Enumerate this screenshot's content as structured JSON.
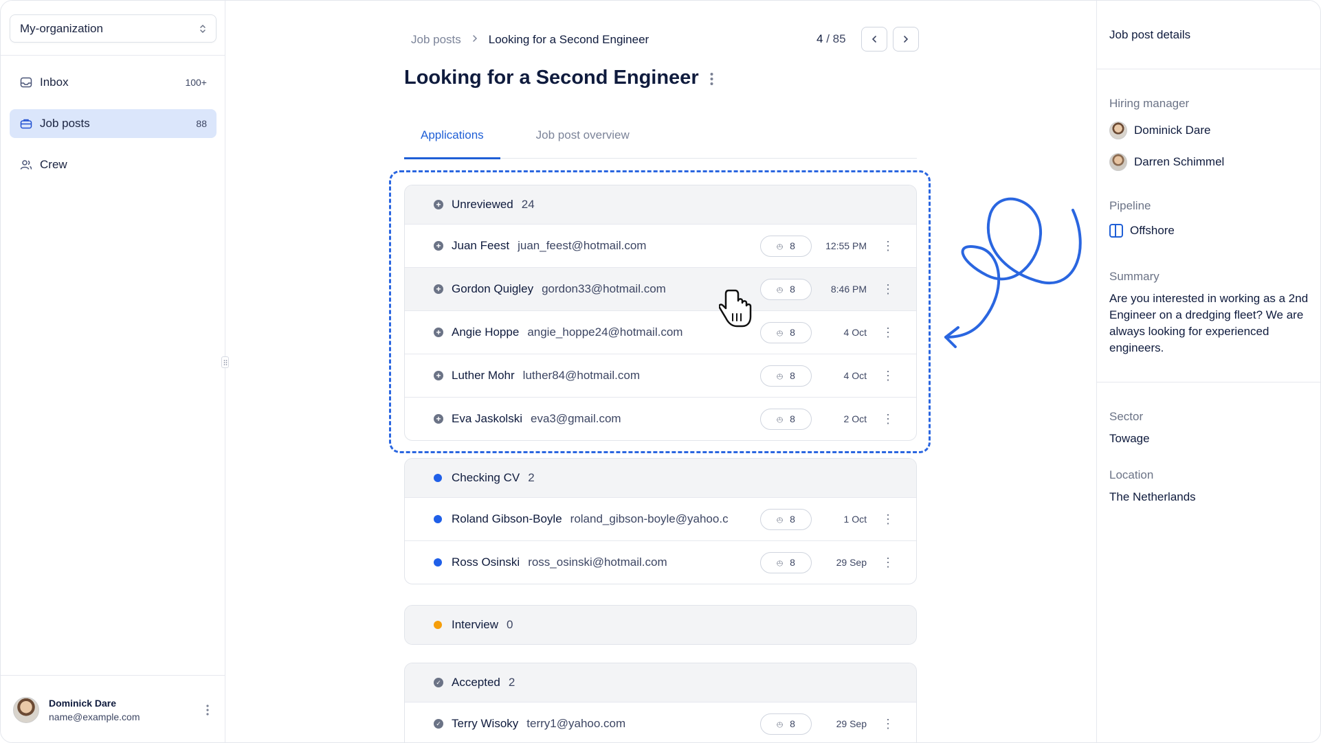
{
  "sidebar": {
    "org": "My-organization",
    "items": [
      {
        "label": "Inbox",
        "count": "100+",
        "icon": "inbox-icon"
      },
      {
        "label": "Job posts",
        "count": "88",
        "icon": "briefcase-icon"
      },
      {
        "label": "Crew",
        "count": "",
        "icon": "users-icon"
      }
    ],
    "user": {
      "name": "Dominick Dare",
      "email": "name@example.com"
    }
  },
  "header": {
    "breadcrumb": [
      "Job posts",
      "Looking for a Second Engineer"
    ],
    "pager": {
      "current": "4",
      "separator": "/",
      "total": "85"
    },
    "title": "Looking for a Second Engineer"
  },
  "tabs": [
    "Applications",
    "Job post overview"
  ],
  "groups": [
    {
      "name": "Unreviewed",
      "count": "24",
      "status": "unreviewed",
      "rows": [
        {
          "name": "Juan Feest",
          "email": "juan_feest@hotmail.com",
          "attachments": "8",
          "date": "12:55 PM"
        },
        {
          "name": "Gordon Quigley",
          "email": "gordon33@hotmail.com",
          "attachments": "8",
          "date": "8:46 PM"
        },
        {
          "name": "Angie Hoppe",
          "email": "angie_hoppe24@hotmail.com",
          "attachments": "8",
          "date": "4 Oct"
        },
        {
          "name": "Luther Mohr",
          "email": "luther84@hotmail.com",
          "attachments": "8",
          "date": "4 Oct"
        },
        {
          "name": "Eva Jaskolski",
          "email": "eva3@gmail.com",
          "attachments": "8",
          "date": "2 Oct"
        }
      ]
    },
    {
      "name": "Checking CV",
      "count": "2",
      "status": "checking",
      "color": "#1f5fe8",
      "rows": [
        {
          "name": "Roland Gibson-Boyle",
          "email": "roland_gibson-boyle@yahoo.c",
          "attachments": "8",
          "date": "1 Oct"
        },
        {
          "name": "Ross Osinski",
          "email": "ross_osinski@hotmail.com",
          "attachments": "8",
          "date": "29 Sep"
        }
      ]
    },
    {
      "name": "Interview",
      "count": "0",
      "status": "interview",
      "color": "#f59e0b",
      "rows": []
    },
    {
      "name": "Accepted",
      "count": "2",
      "status": "accepted",
      "rows": [
        {
          "name": "Terry Wisoky",
          "email": "terry1@yahoo.com",
          "attachments": "8",
          "date": "29 Sep"
        }
      ]
    }
  ],
  "details": {
    "title": "Job post details",
    "hiring_manager_label": "Hiring manager",
    "managers": [
      "Dominick Dare",
      "Darren Schimmel"
    ],
    "pipeline_label": "Pipeline",
    "pipeline": "Offshore",
    "summary_label": "Summary",
    "summary": "Are you interested in working as a 2nd Engineer on a dredging fleet? We are always looking for experienced engineers.",
    "sector_label": "Sector",
    "sector": "Towage",
    "location_label": "Location",
    "location": "The Netherlands"
  },
  "colors": {
    "accent": "#1f5fd6",
    "annotation": "#2a66e0",
    "active_nav_bg": "#dbe6fb"
  }
}
